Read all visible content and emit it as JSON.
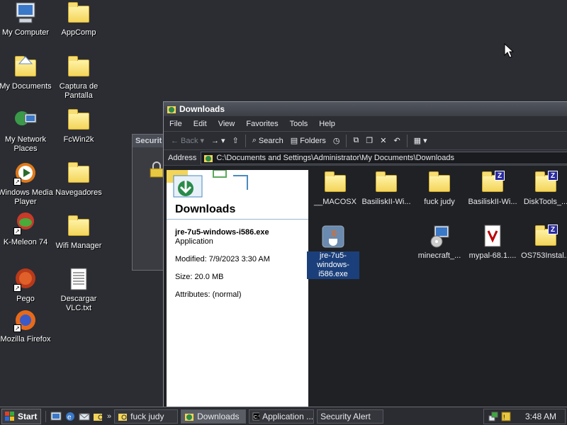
{
  "desktop": {
    "icons": [
      {
        "label": "My Computer"
      },
      {
        "label": "AppComp"
      },
      {
        "label": "My Documents"
      },
      {
        "label": "Captura de Pantalla"
      },
      {
        "label": "My Network Places"
      },
      {
        "label": "FcWin2k"
      },
      {
        "label": "Windows Media Player"
      },
      {
        "label": "Navegadores"
      },
      {
        "label": "K-Meleon 74"
      },
      {
        "label": "Wifi Manager"
      },
      {
        "label": "Pego"
      },
      {
        "label": "Descargar VLC.txt"
      },
      {
        "label": "Mozilla Firefox"
      }
    ]
  },
  "background_window": {
    "title": "Securit"
  },
  "explorer": {
    "title": "Downloads",
    "menu": [
      "File",
      "Edit",
      "View",
      "Favorites",
      "Tools",
      "Help"
    ],
    "toolbar": {
      "back": "Back",
      "search": "Search",
      "folders": "Folders"
    },
    "address_label": "Address",
    "address_value": "C:\\Documents and Settings\\Administrator\\My Documents\\Downloads",
    "taskpane": {
      "title": "Downloads",
      "filename": "jre-7u5-windows-i586.exe",
      "type": "Application",
      "modified": "Modified: 7/9/2023 3:30 AM",
      "size": "Size: 20.0 MB",
      "attributes": "Attributes: (normal)"
    },
    "files": [
      {
        "label": "__MACOSX"
      },
      {
        "label": "BasiliskII-Wi..."
      },
      {
        "label": "fuck judy"
      },
      {
        "label": "BasiliskII-Wi..."
      },
      {
        "label": "DiskTools_..."
      },
      {
        "label": "jre-7u5-windows-i586.exe"
      },
      {
        "label": "minecraft_..."
      },
      {
        "label": "mypal-68.1...."
      },
      {
        "label": "OS753Instal..."
      }
    ]
  },
  "taskbar": {
    "start": "Start",
    "tasks": [
      {
        "label": "fuck judy"
      },
      {
        "label": "Downloads"
      },
      {
        "label": "Application ..."
      },
      {
        "label": "Security Alert"
      }
    ],
    "clock": "3:48 AM"
  },
  "colors": {
    "desktop": "#2b2d33",
    "folder": "#f3d55a",
    "selection": "#1b3f7a"
  }
}
